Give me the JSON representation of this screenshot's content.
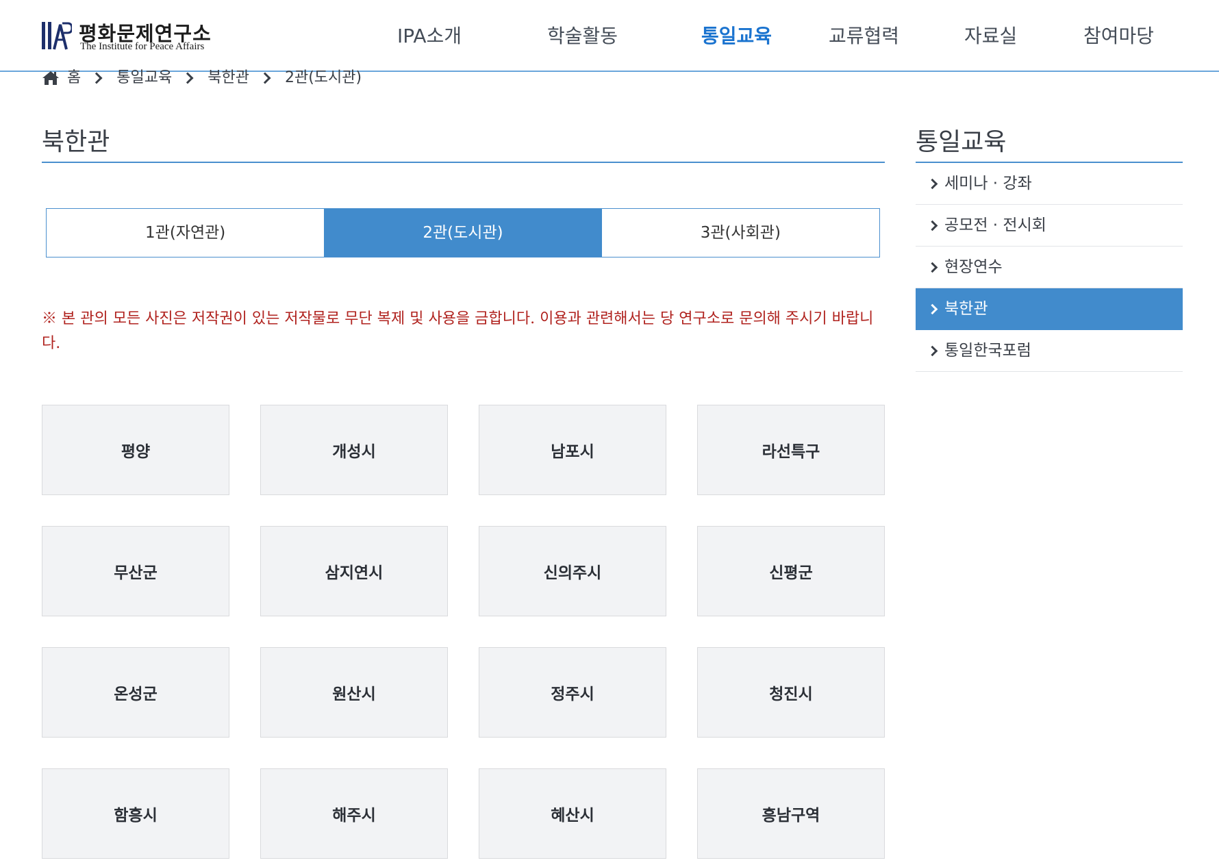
{
  "header": {
    "logo": {
      "ko": "평화문제연구소",
      "en": "The Institute for Peace Affairs",
      "mark": "IAP"
    },
    "nav": [
      {
        "label": "IPA소개",
        "active": false
      },
      {
        "label": "학술활동",
        "active": false
      },
      {
        "label": "통일교육",
        "active": true
      },
      {
        "label": "교류협력",
        "active": false
      },
      {
        "label": "자료실",
        "active": false
      },
      {
        "label": "참여마당",
        "active": false
      }
    ]
  },
  "breadcrumb": {
    "home": "홈",
    "items": [
      "통일교육",
      "북한관",
      "2관(도시관)"
    ]
  },
  "main": {
    "title": "북한관",
    "tabs": [
      {
        "label": "1관(자연관)",
        "active": false
      },
      {
        "label": "2관(도시관)",
        "active": true
      },
      {
        "label": "3관(사회관)",
        "active": false
      }
    ],
    "notice": "※ 본 관의 모든 사진은 저작권이 있는 저작물로 무단 복제 및 사용을 금합니다. 이용과 관련해서는 당 연구소로 문의해 주시기 바랍니다.",
    "cities": [
      "평양",
      "개성시",
      "남포시",
      "라선특구",
      "무산군",
      "삼지연시",
      "신의주시",
      "신평군",
      "온성군",
      "원산시",
      "정주시",
      "청진시",
      "함흥시",
      "해주시",
      "혜산시",
      "흥남구역"
    ]
  },
  "sidebar": {
    "title": "통일교육",
    "items": [
      {
        "label": "세미나 · 강좌",
        "active": false
      },
      {
        "label": "공모전 · 전시회",
        "active": false
      },
      {
        "label": "현장연수",
        "active": false
      },
      {
        "label": "북한관",
        "active": true
      },
      {
        "label": "통일한국포럼",
        "active": false
      }
    ]
  },
  "colors": {
    "accent": "#418bcc",
    "nav_active": "#1a73cf",
    "notice": "#b0221e",
    "card_bg": "#f2f3f5"
  }
}
